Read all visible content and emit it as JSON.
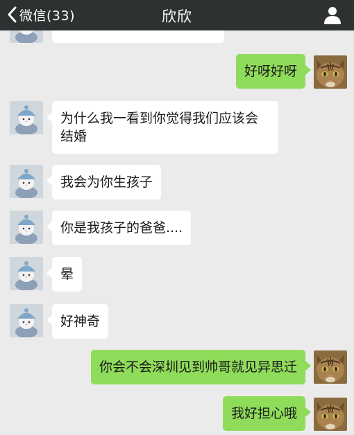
{
  "header": {
    "back_label": "微信(33)",
    "title": "欣欣"
  },
  "colors": {
    "topbar": "#2e3132",
    "background": "#ebebeb",
    "sent_bubble": "#8fdc5a",
    "received_bubble": "#ffffff"
  },
  "icons": {
    "back": "chevron-left-icon",
    "profile": "person-icon"
  },
  "messages": [
    {
      "from": "contact",
      "text": ""
    },
    {
      "from": "me",
      "text": "好呀好呀"
    },
    {
      "from": "contact",
      "text": "为什么我一看到你觉得我们应该会\n结婚"
    },
    {
      "from": "contact",
      "text": "我会为你生孩子"
    },
    {
      "from": "contact",
      "text": "你是我孩子的爸爸...."
    },
    {
      "from": "contact",
      "text": "晕"
    },
    {
      "from": "contact",
      "text": "好神奇"
    },
    {
      "from": "me",
      "text": "你会不会深圳见到帅哥就见异思迁"
    },
    {
      "from": "me",
      "text": "我好担心哦"
    }
  ]
}
